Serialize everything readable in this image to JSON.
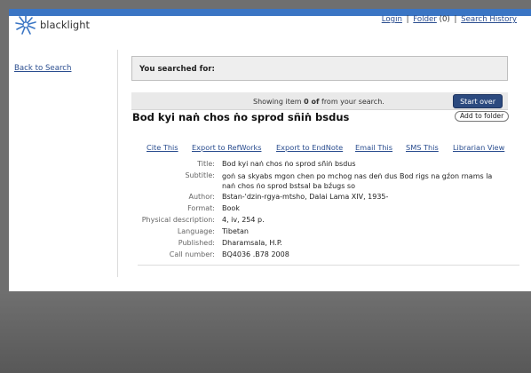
{
  "header": {
    "logo_text": "blacklight",
    "login": "Login",
    "folder": "Folder",
    "folder_count": "(0)",
    "search_history": "Search History",
    "sep": "|"
  },
  "sidebar": {
    "back_link": "Back to Search"
  },
  "search": {
    "you_searched_for": "You searched for:"
  },
  "pager": {
    "prefix": "Showing item",
    "item": "0 of",
    "suffix": "from your search.",
    "start_over": "Start over"
  },
  "record": {
    "title": "Bod kyi naṅ chos ṅo sprod sñiṅ bsdus",
    "add_to_folder": "Add to folder",
    "tools": [
      "Cite This",
      "Export to RefWorks",
      "Export to EndNote",
      "Email This",
      "SMS This",
      "Librarian View"
    ],
    "fields": [
      {
        "label": "Title:",
        "value": "Bod kyi naṅ chos ṅo sprod sñiṅ bsdus"
      },
      {
        "label": "Subtitle:",
        "value": "goṅ sa skyabs mgon chen po mchog nas deṅ dus Bod rigs na gźon rnams la naṅ chos ṅo sprod bstsal ba bźugs so"
      },
      {
        "label": "Author:",
        "value": "Bstan-'dzin-rgya-mtsho, Dalai Lama XIV, 1935-"
      },
      {
        "label": "Format:",
        "value": "Book"
      },
      {
        "label": "Physical description:",
        "value": "4, iv, 254 p."
      },
      {
        "label": "Language:",
        "value": "Tibetan"
      },
      {
        "label": "Published:",
        "value": "Dharamsala, H.P."
      },
      {
        "label": "Call number:",
        "value": "BQ4036 .B78 2008"
      }
    ]
  },
  "colors": {
    "topbar": "#3a75c4",
    "link": "#2a4d8f",
    "button": "#2c4a7f"
  }
}
